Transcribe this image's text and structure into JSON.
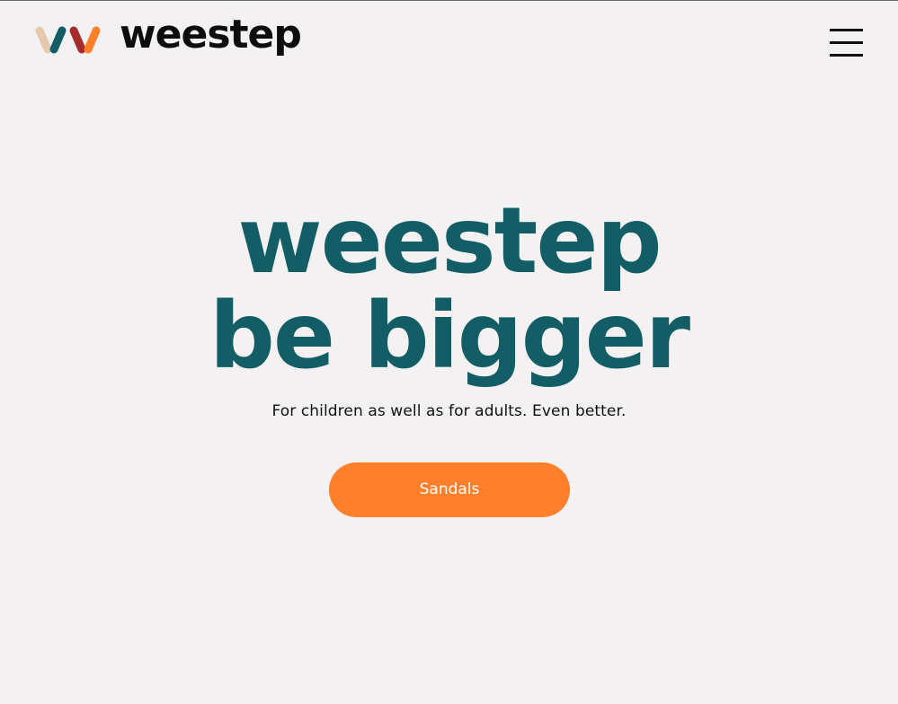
{
  "header": {
    "logo_text": "weestep",
    "logo_colors": [
      "#e6c9ac",
      "#135e66",
      "#a62b2b",
      "#ff7f2a"
    ],
    "menu_icon": "hamburger-menu-icon"
  },
  "hero": {
    "title_line1": "weestep",
    "title_line2": "be bigger",
    "subtitle": "For children as well as for adults. Even better.",
    "cta_label": "Sandals"
  },
  "colors": {
    "background": "#f3f1f2",
    "title": "#135e66",
    "accent": "#ff7f2a",
    "text": "#111111"
  }
}
